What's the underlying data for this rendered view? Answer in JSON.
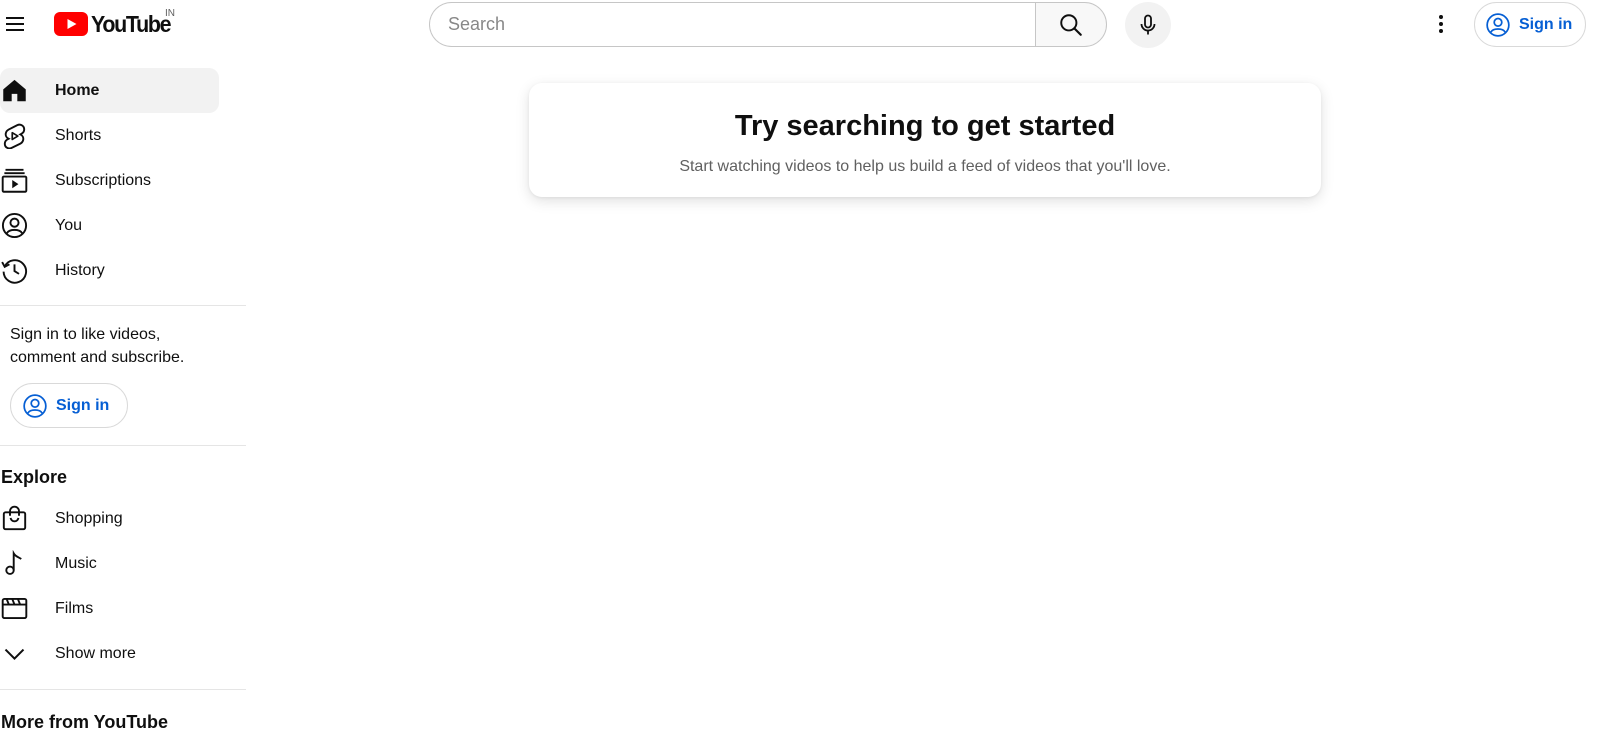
{
  "header": {
    "logo_text": "YouTube",
    "country_code": "IN",
    "search_placeholder": "Search",
    "signin_label": "Sign in"
  },
  "sidebar": {
    "primary": [
      {
        "label": "Home",
        "icon": "home-icon",
        "active": true
      },
      {
        "label": "Shorts",
        "icon": "shorts-icon",
        "active": false
      },
      {
        "label": "Subscriptions",
        "icon": "subscriptions-icon",
        "active": false
      },
      {
        "label": "You",
        "icon": "you-icon",
        "active": false
      },
      {
        "label": "History",
        "icon": "history-icon",
        "active": false
      }
    ],
    "signin_promo": {
      "text": "Sign in to like videos, comment and subscribe.",
      "button_label": "Sign in"
    },
    "explore": {
      "title": "Explore",
      "items": [
        {
          "label": "Shopping",
          "icon": "shopping-bag-icon"
        },
        {
          "label": "Music",
          "icon": "music-note-icon"
        },
        {
          "label": "Films",
          "icon": "films-icon"
        },
        {
          "label": "Show more",
          "icon": "chevron-down-icon"
        }
      ]
    },
    "more_title": "More from YouTube"
  },
  "main": {
    "empty_title": "Try searching to get started",
    "empty_subtitle": "Start watching videos to help us build a feed of videos that you'll love."
  },
  "colors": {
    "brand_red": "#ff0000",
    "link_blue": "#065fd4",
    "active_bg": "#f2f2f2",
    "text": "#0f0f0f",
    "secondary_text": "#606060"
  }
}
